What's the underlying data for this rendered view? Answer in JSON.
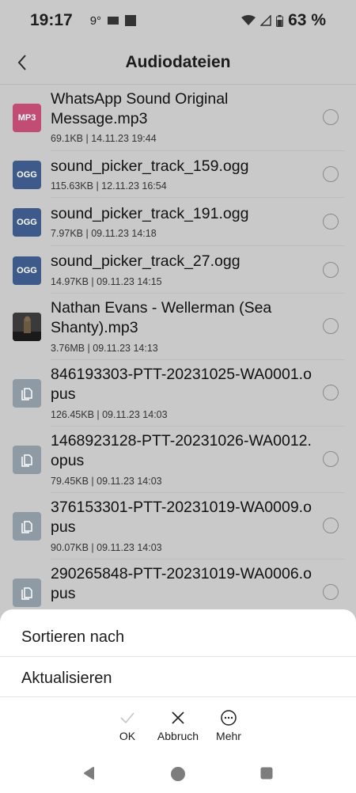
{
  "status_bar": {
    "time": "19:17",
    "temperature": "9°",
    "battery": "63 %"
  },
  "header": {
    "title": "Audiodateien"
  },
  "files": [
    {
      "name": "WhatsApp Sound Original Message.mp3",
      "meta": "69.1KB | 14.11.23 19:44",
      "icon": "MP3"
    },
    {
      "name": "sound_picker_track_159.ogg",
      "meta": "115.63KB | 12.11.23 16:54",
      "icon": "OGG"
    },
    {
      "name": "sound_picker_track_191.ogg",
      "meta": "7.97KB | 09.11.23 14:18",
      "icon": "OGG"
    },
    {
      "name": "sound_picker_track_27.ogg",
      "meta": "14.97KB | 09.11.23 14:15",
      "icon": "OGG"
    },
    {
      "name": "Nathan Evans - Wellerman (Sea Shanty).mp3",
      "meta": "3.76MB | 09.11.23 14:13",
      "icon": "album-thumbnail"
    },
    {
      "name": "846193303-PTT-20231025-WA0001.opus",
      "meta": "126.45KB | 09.11.23 14:03",
      "icon": "document-icon"
    },
    {
      "name": "1468923128-PTT-20231026-WA0012.opus",
      "meta": "79.45KB | 09.11.23 14:03",
      "icon": "document-icon"
    },
    {
      "name": "376153301-PTT-20231019-WA0009.opus",
      "meta": "90.07KB | 09.11.23 14:03",
      "icon": "document-icon"
    },
    {
      "name": "290265848-PTT-20231019-WA0006.opus",
      "meta": "",
      "icon": "document-icon"
    }
  ],
  "name_lines": [
    [
      "WhatsApp Sound Original",
      "Message.mp3"
    ],
    [
      "sound_picker_track_159.ogg"
    ],
    [
      "sound_picker_track_191.ogg"
    ],
    [
      "sound_picker_track_27.ogg"
    ],
    [
      "Nathan Evans - Wellerman (Sea",
      "Shanty).mp3"
    ],
    [
      "846193303-PTT-20231025-WA0001.o",
      "pus"
    ],
    [
      "1468923128-PTT-20231026-WA0012.",
      "opus"
    ],
    [
      "376153301-PTT-20231019-WA0009.o",
      "pus"
    ],
    [
      "290265848-PTT-20231019-WA0006.o",
      "pus"
    ]
  ],
  "sheet": {
    "sort_label": "Sortieren nach",
    "refresh_label": "Aktualisieren",
    "ok_label": "OK",
    "cancel_label": "Abbruch",
    "more_label": "Mehr"
  },
  "colors": {
    "mp3": "#c14d74",
    "ogg": "#3e5a8a",
    "doc": "#8e9aa4",
    "scrim_background": "#c9c9c9"
  }
}
